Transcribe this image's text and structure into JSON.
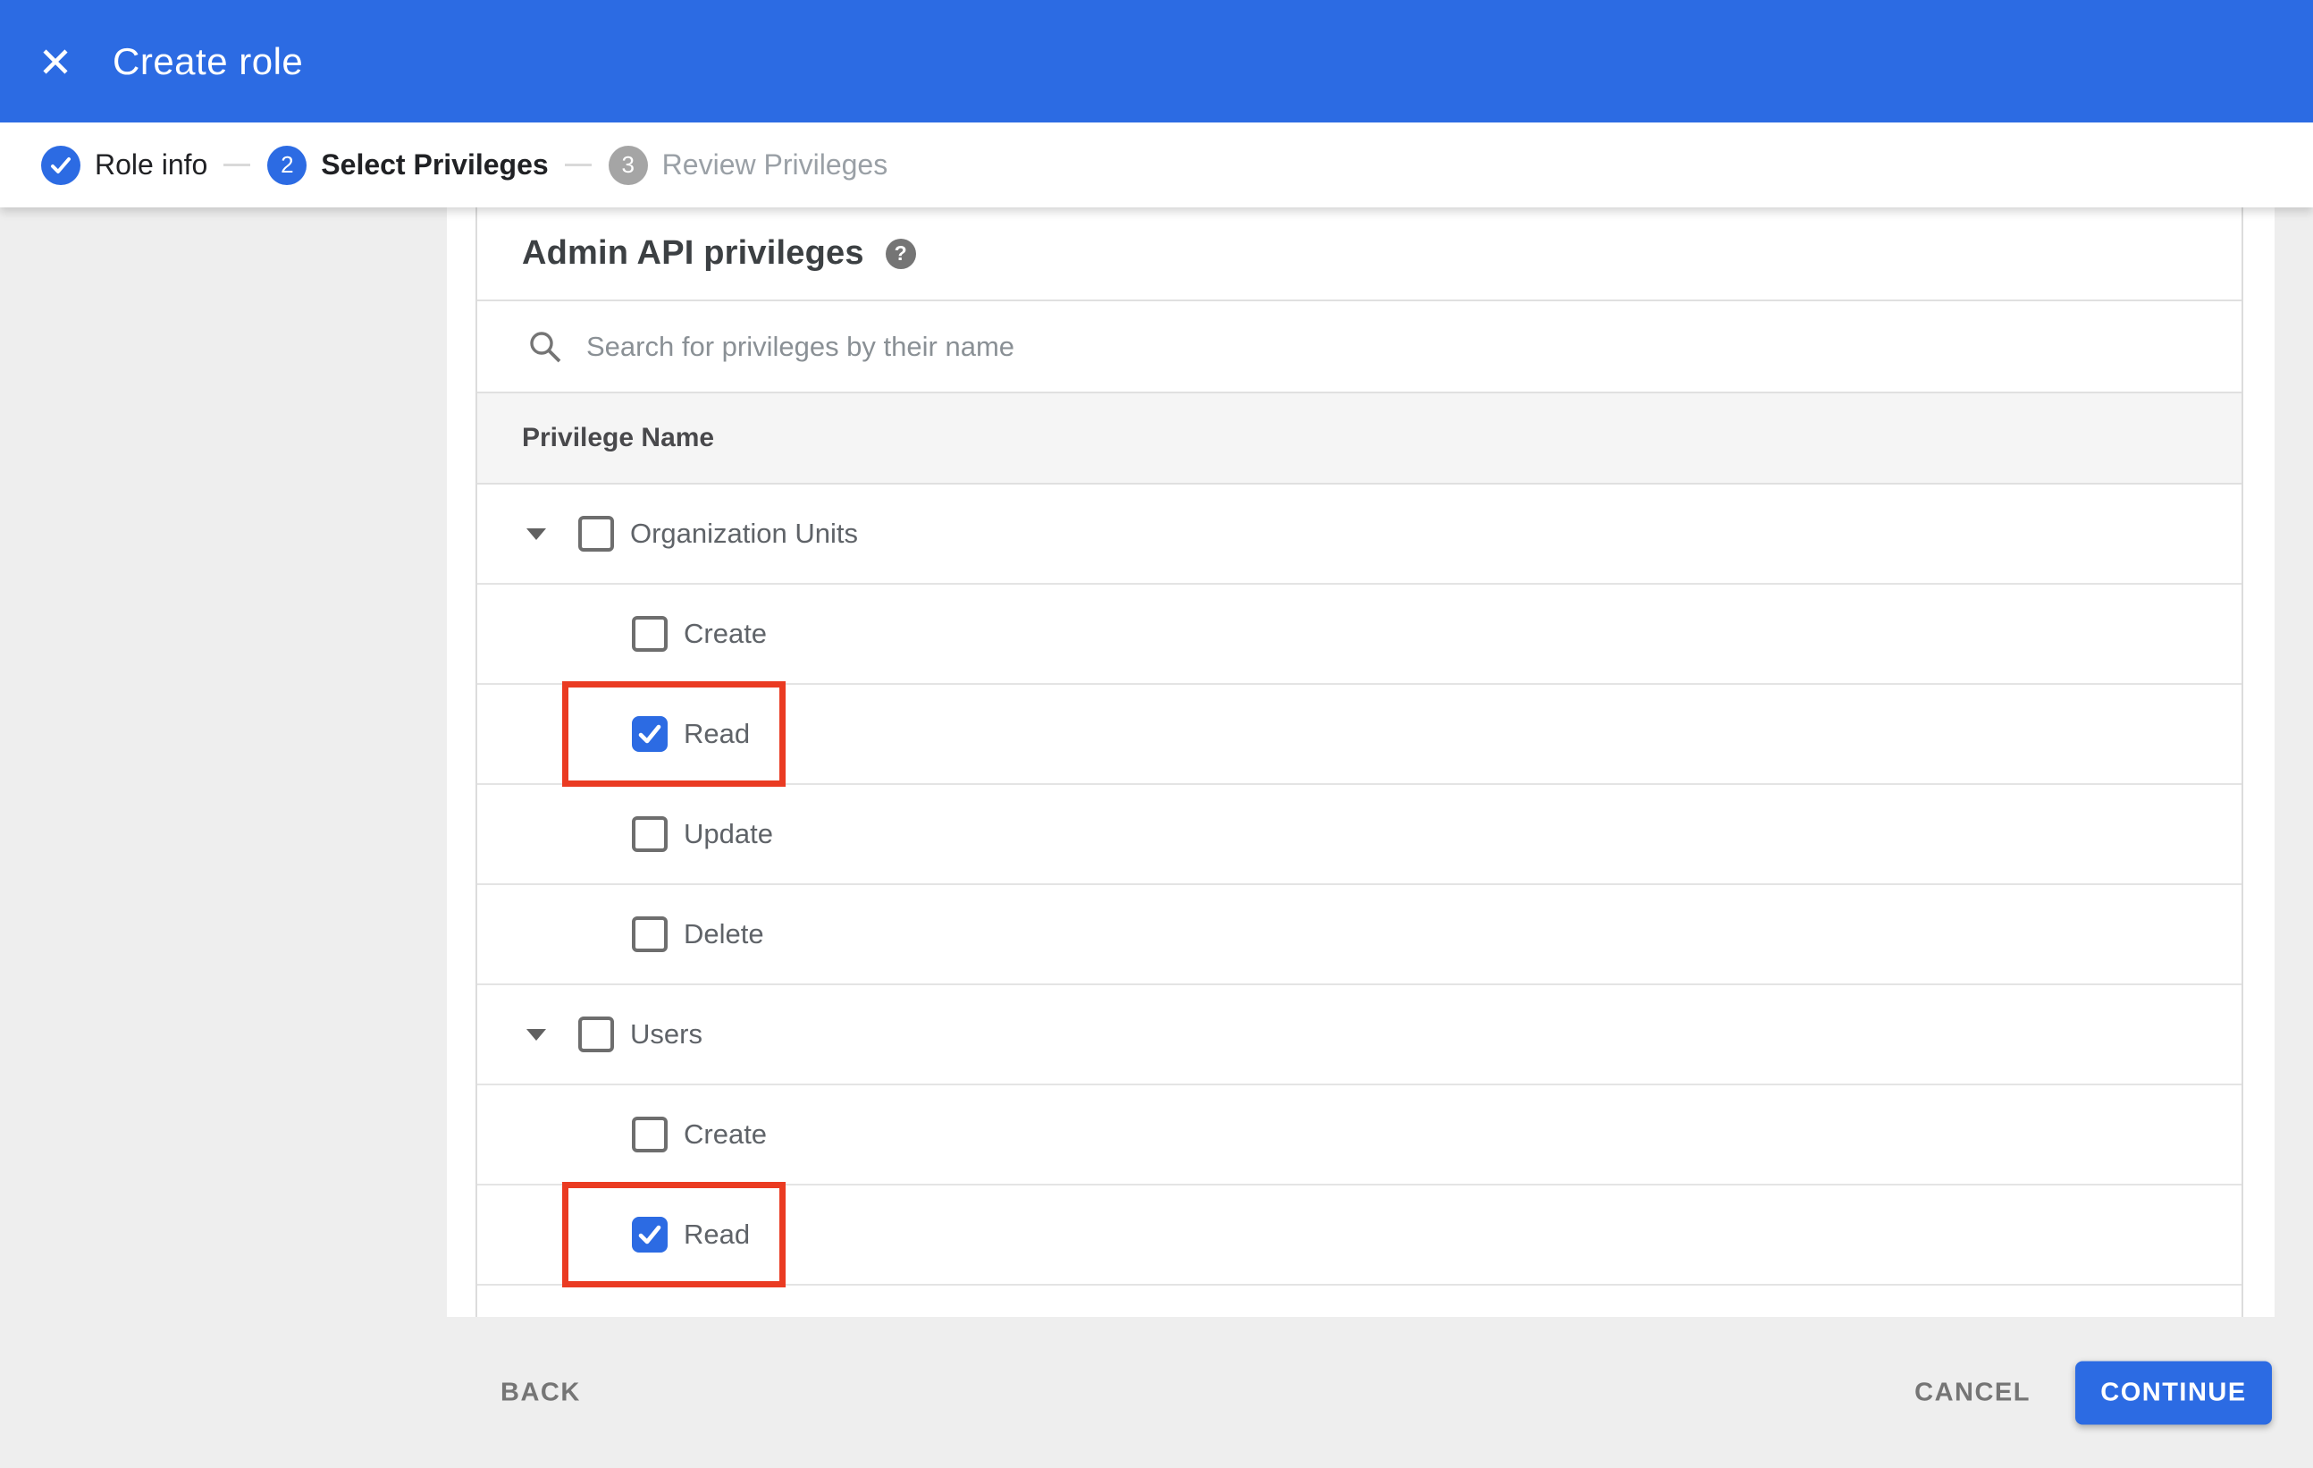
{
  "app_bar": {
    "title": "Create role"
  },
  "stepper": {
    "steps": [
      {
        "label": "Role info",
        "status": "completed"
      },
      {
        "label": "Select Privileges",
        "status": "active",
        "number": "2"
      },
      {
        "label": "Review Privileges",
        "status": "upcoming",
        "number": "3"
      }
    ]
  },
  "privileges_panel": {
    "heading": "Admin API privileges",
    "help_icon": "?",
    "search_placeholder": "Search for privileges by their name",
    "column_header": "Privilege Name",
    "rows": [
      {
        "label": "Organization Units",
        "level": "group",
        "checked": false,
        "expanded": true,
        "highlighted": false
      },
      {
        "label": "Create",
        "level": "child",
        "checked": false,
        "highlighted": false
      },
      {
        "label": "Read",
        "level": "child",
        "checked": true,
        "highlighted": true
      },
      {
        "label": "Update",
        "level": "child",
        "checked": false,
        "highlighted": false
      },
      {
        "label": "Delete",
        "level": "child",
        "checked": false,
        "highlighted": false
      },
      {
        "label": "Users",
        "level": "group",
        "checked": false,
        "expanded": true,
        "highlighted": false
      },
      {
        "label": "Create",
        "level": "child",
        "checked": false,
        "highlighted": false
      },
      {
        "label": "Read",
        "level": "child",
        "checked": true,
        "highlighted": true
      }
    ]
  },
  "footer": {
    "back": "BACK",
    "cancel": "CANCEL",
    "continue": "CONTINUE"
  },
  "colors": {
    "app_bar_blue": "#2c6be3",
    "accent_blue": "#2c6be3",
    "step_inactive_gray": "#a5a5a5",
    "highlight_red": "#ea3b22",
    "panel_gray": "#eeeeee",
    "table_header_gray": "#f5f5f5"
  }
}
